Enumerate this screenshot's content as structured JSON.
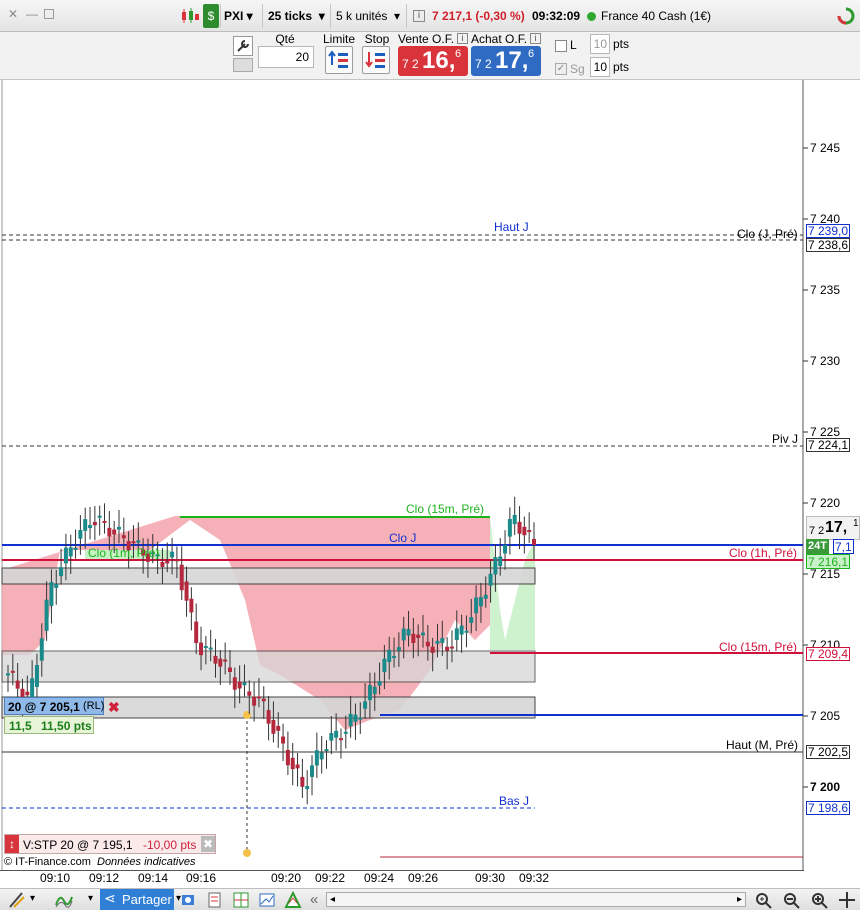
{
  "topbar": {
    "symbol": "PXI",
    "timeframe": "25 ticks",
    "units": "5 k unités",
    "quote": "7 217,1 (-0,30 %)",
    "time": "09:32:09",
    "instrument": "France 40 Cash (1€)"
  },
  "orderbar": {
    "qty_label": "Qté",
    "qty_value": "20",
    "limit_label": "Limite",
    "stop_label": "Stop",
    "sell_label": "Vente O.F.",
    "sell_prefix": "7 2",
    "sell_big": "16,",
    "sell_small": "6",
    "buy_label": "Achat O.F.",
    "buy_prefix": "7 2",
    "buy_big": "17,",
    "buy_small": "6",
    "l_label": "L",
    "l_value": "10",
    "l_unit": "pts",
    "sg_label": "Sg",
    "sg_value": "10",
    "sg_unit": "pts"
  },
  "price_axis": {
    "ticks": [
      "7 245",
      "7 240",
      "7 235",
      "7 230",
      "7 225",
      "7 220",
      "7 215",
      "7 210",
      "7 205",
      "7 200"
    ],
    "current_prefix": "7 2",
    "current_big": "17,",
    "current_small": "1",
    "badge_time": "24T",
    "badge_value": "7,1"
  },
  "levels": {
    "haut_j": "Haut J",
    "clo_j_pre": "Clo (J, Pré)",
    "haut_j_value": "7 239,0",
    "clo_j_pre_value": "7 238,6",
    "piv_j": "Piv J",
    "piv_j_value": "7 224,1",
    "clo_15m_pre_top": "Clo (15m, Pré)",
    "clo_j": "Clo J",
    "clo_1h_pre": "Clo (1h, Pré)",
    "clo_1h_pre_value": "7 216,1",
    "clo_15m_pre": "Clo (15m, Pré)",
    "clo_15m_pre_value": "7 209,4",
    "haut_m_pre": "Haut (M, Pré)",
    "haut_m_pre_value": "7 202,5",
    "bas_j": "Bas J",
    "bas_j_value": "7 198,6",
    "overlay_label": "Clo (1m, Pré)"
  },
  "orders": {
    "limit_order": "20 @ 7 205,1",
    "limit_tag": "(RL)",
    "limit_dist": "11,5",
    "limit_pts": "11,50 pts",
    "stop_order": "V:STP  20 @ 7 195,1",
    "stop_pts": "-10,00 pts"
  },
  "footer": {
    "copyright": "© IT-Finance.com",
    "notice": "Données indicatives"
  },
  "time_axis": [
    "09:10",
    "09:12",
    "09:14",
    "09:16",
    "09:20",
    "09:22",
    "09:24",
    "09:26",
    "09:30",
    "09:32"
  ],
  "bottombar": {
    "share_label": "Partager"
  },
  "colors": {
    "sell": "#d9343c",
    "buy": "#2f6bc2",
    "bull": "#1a8a8a",
    "bear": "#b3283c",
    "level_blue": "#1030d0",
    "level_red": "#d0103a",
    "level_green": "#1bb31b"
  },
  "chart_data": {
    "type": "candlestick",
    "ylim": [
      7196,
      7250
    ],
    "x": [
      "09:10",
      "09:12",
      "09:14",
      "09:16",
      "09:20",
      "09:22",
      "09:24",
      "09:26",
      "09:30",
      "09:32"
    ],
    "close_series": [
      7208,
      7206,
      7214,
      7217,
      7219,
      7218,
      7217,
      7216,
      7216,
      7210,
      7209,
      7207,
      7206,
      7203,
      7200,
      7203,
      7204,
      7206,
      7209,
      7211,
      7210,
      7210,
      7212,
      7215,
      7219,
      7217
    ]
  }
}
